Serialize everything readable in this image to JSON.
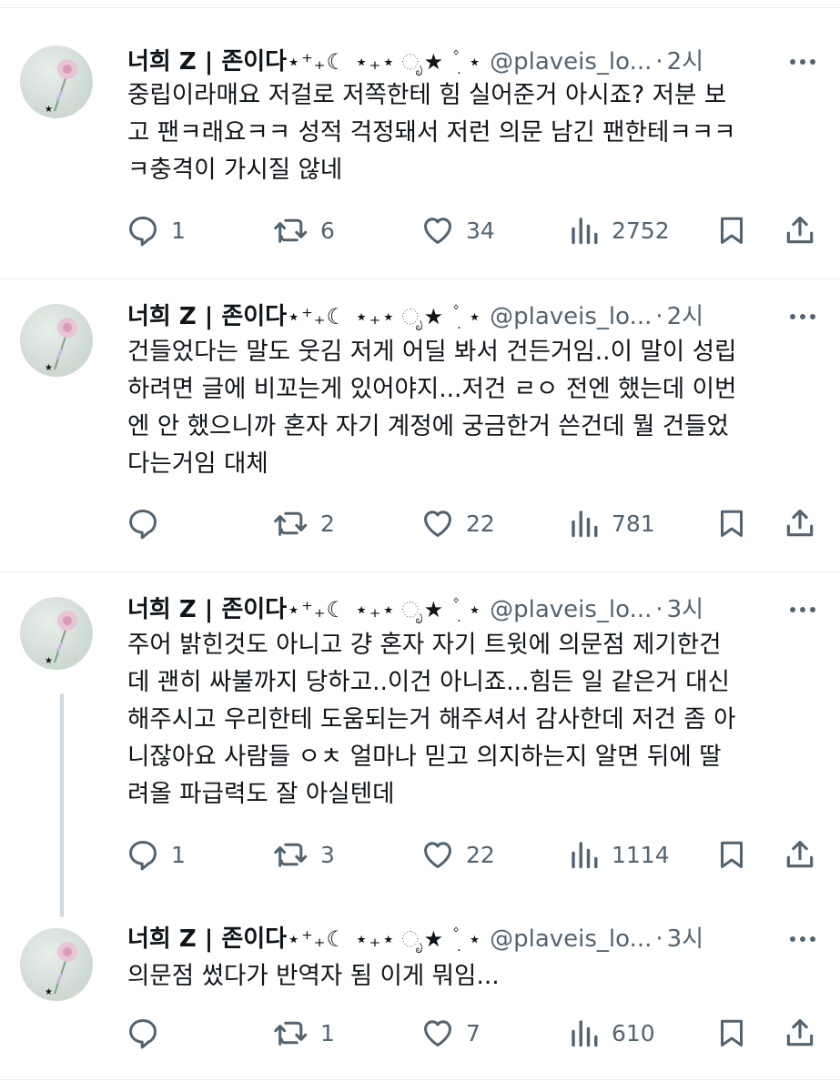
{
  "tweets": [
    {
      "display_name": "너희 Z | 존이다",
      "decoration": "⋆⁺₊☾ ⋆₊⋆ ೃ★ ۫ ׅ ⋆",
      "handle": "@plaveis_lo...",
      "separator": "·",
      "time": "2시",
      "lines": [
        "중립이라매요 저걸로 저쪽한테 힘 실어준거 아시죠? 저분 보",
        "고 팬ㅋ래요ㅋㅋ 성적 걱정돼서 저런 의문 남긴 팬한테ㅋㅋㅋ",
        "ㅋ충격이 가시질 않네"
      ],
      "replies": "1",
      "retweets": "6",
      "likes": "34",
      "views": "2752"
    },
    {
      "display_name": "너희 Z | 존이다",
      "decoration": "⋆⁺₊☾ ⋆₊⋆ ೃ★ ۫ ׅ ⋆",
      "handle": "@plaveis_lo...",
      "separator": "·",
      "time": "2시",
      "lines": [
        "건들었다는 말도 웃김 저게 어딜 봐서 건든거임..이 말이 성립",
        "하려면 글에 비꼬는게 있어야지...저건 ㄹㅇ 전엔 했는데 이번",
        "엔 안 했으니까 혼자 자기 계정에 궁금한거 쓴건데 뭘 건들었",
        "다는거임 대체"
      ],
      "replies": "",
      "retweets": "2",
      "likes": "22",
      "views": "781"
    },
    {
      "display_name": "너희 Z | 존이다",
      "decoration": "⋆⁺₊☾ ⋆₊⋆ ೃ★ ۫ ׅ ⋆",
      "handle": "@plaveis_lo...",
      "separator": "·",
      "time": "3시",
      "lines": [
        "주어 밝힌것도 아니고 걍 혼자 자기 트윗에 의문점 제기한건",
        "데 괜히 싸불까지 당하고..이건 아니죠...힘든 일 같은거 대신",
        "해주시고 우리한테 도움되는거 해주셔서 감사한데 저건 좀 아",
        "니잖아요 사람들 ㅇㅊ 얼마나 믿고 의지하는지 알면 뒤에 딸",
        "려올 파급력도 잘 아실텐데"
      ],
      "replies": "1",
      "retweets": "3",
      "likes": "22",
      "views": "1114"
    },
    {
      "display_name": "너희 Z | 존이다",
      "decoration": "⋆⁺₊☾ ⋆₊⋆ ೃ★ ۫ ׅ ⋆",
      "handle": "@plaveis_lo...",
      "separator": "·",
      "time": "3시",
      "lines": [
        "의문점 썼다가 반역자 됨 이게 뭐임..."
      ],
      "replies": "",
      "retweets": "1",
      "likes": "7",
      "views": "610"
    }
  ],
  "icons": {
    "reply": "reply-icon",
    "retweet": "retweet-icon",
    "like": "heart-icon",
    "views": "views-icon",
    "bookmark": "bookmark-icon",
    "share": "share-icon",
    "more": "more-icon"
  },
  "colors": {
    "text": "#0f1419",
    "muted": "#536471",
    "divider": "#e6e9eb",
    "thread_line": "#cfd9de"
  }
}
